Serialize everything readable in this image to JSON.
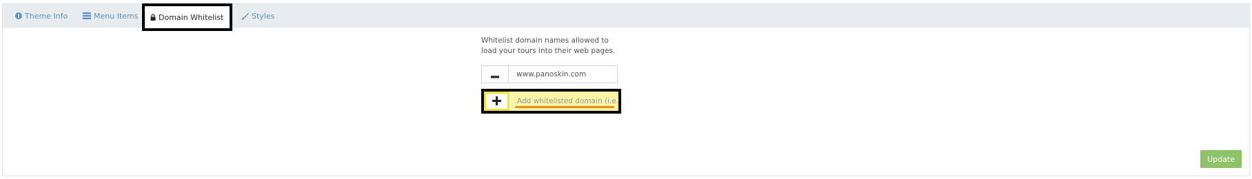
{
  "tabs": [
    {
      "label": "Theme Info",
      "icon": "info-circle-icon"
    },
    {
      "label": "Menu Items",
      "icon": "list-icon"
    },
    {
      "label": "Domain Whitelist",
      "icon": "lock-icon"
    },
    {
      "label": "Styles",
      "icon": "brush-icon"
    }
  ],
  "whitelist": {
    "description": "Whitelist domain names allowed to load your tours into their web pages.",
    "domains": [
      "www.panoskin.com"
    ],
    "add_placeholder": "Add whitelisted domain (i.e."
  },
  "actions": {
    "update_label": "Update"
  },
  "colors": {
    "tab_link": "#5b93c9",
    "tab_bar": "#e8ecef",
    "update_button": "#8fc36a",
    "highlight": "#fbf5a5",
    "underline": "#f08a1c"
  }
}
